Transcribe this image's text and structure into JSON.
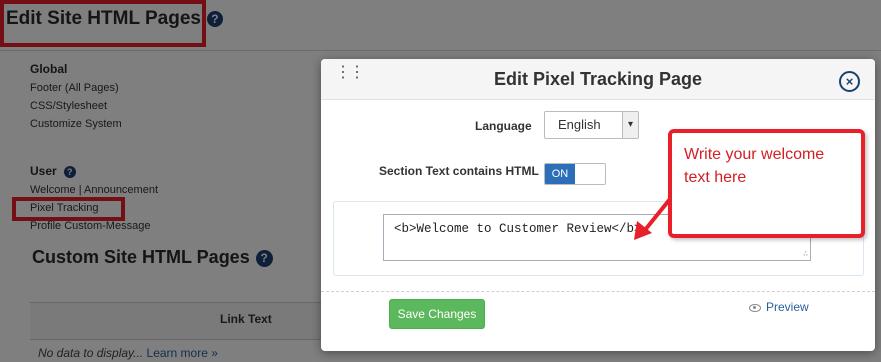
{
  "page": {
    "title": "Edit Site HTML Pages",
    "global_heading": "Global",
    "global_links": [
      "Footer (All Pages)",
      "CSS/Stylesheet",
      "Customize System"
    ],
    "user_heading": "User",
    "user_links": [
      "Welcome | Announcement",
      "Pixel Tracking",
      "Profile Custom-Message"
    ],
    "custom_title": "Custom Site HTML Pages",
    "table_header": "Link Text",
    "no_data": "No data to display...",
    "learn_more": "Learn more »"
  },
  "modal": {
    "title": "Edit Pixel Tracking Page",
    "close_glyph": "×",
    "language_label": "Language",
    "language_value": "English",
    "html_label": "Section Text contains HTML",
    "html_toggle": "ON",
    "text_value": "<b>Welcome to Customer Review</b>",
    "save_label": "Save Changes",
    "preview_label": "Preview"
  },
  "annotation": {
    "callout_text": "Write your welcome text here"
  },
  "colors": {
    "accent_red": "#e8202a",
    "save_green": "#5cb85c",
    "toggle_blue": "#2c6fb8",
    "icon_navy": "#1c3f72"
  }
}
